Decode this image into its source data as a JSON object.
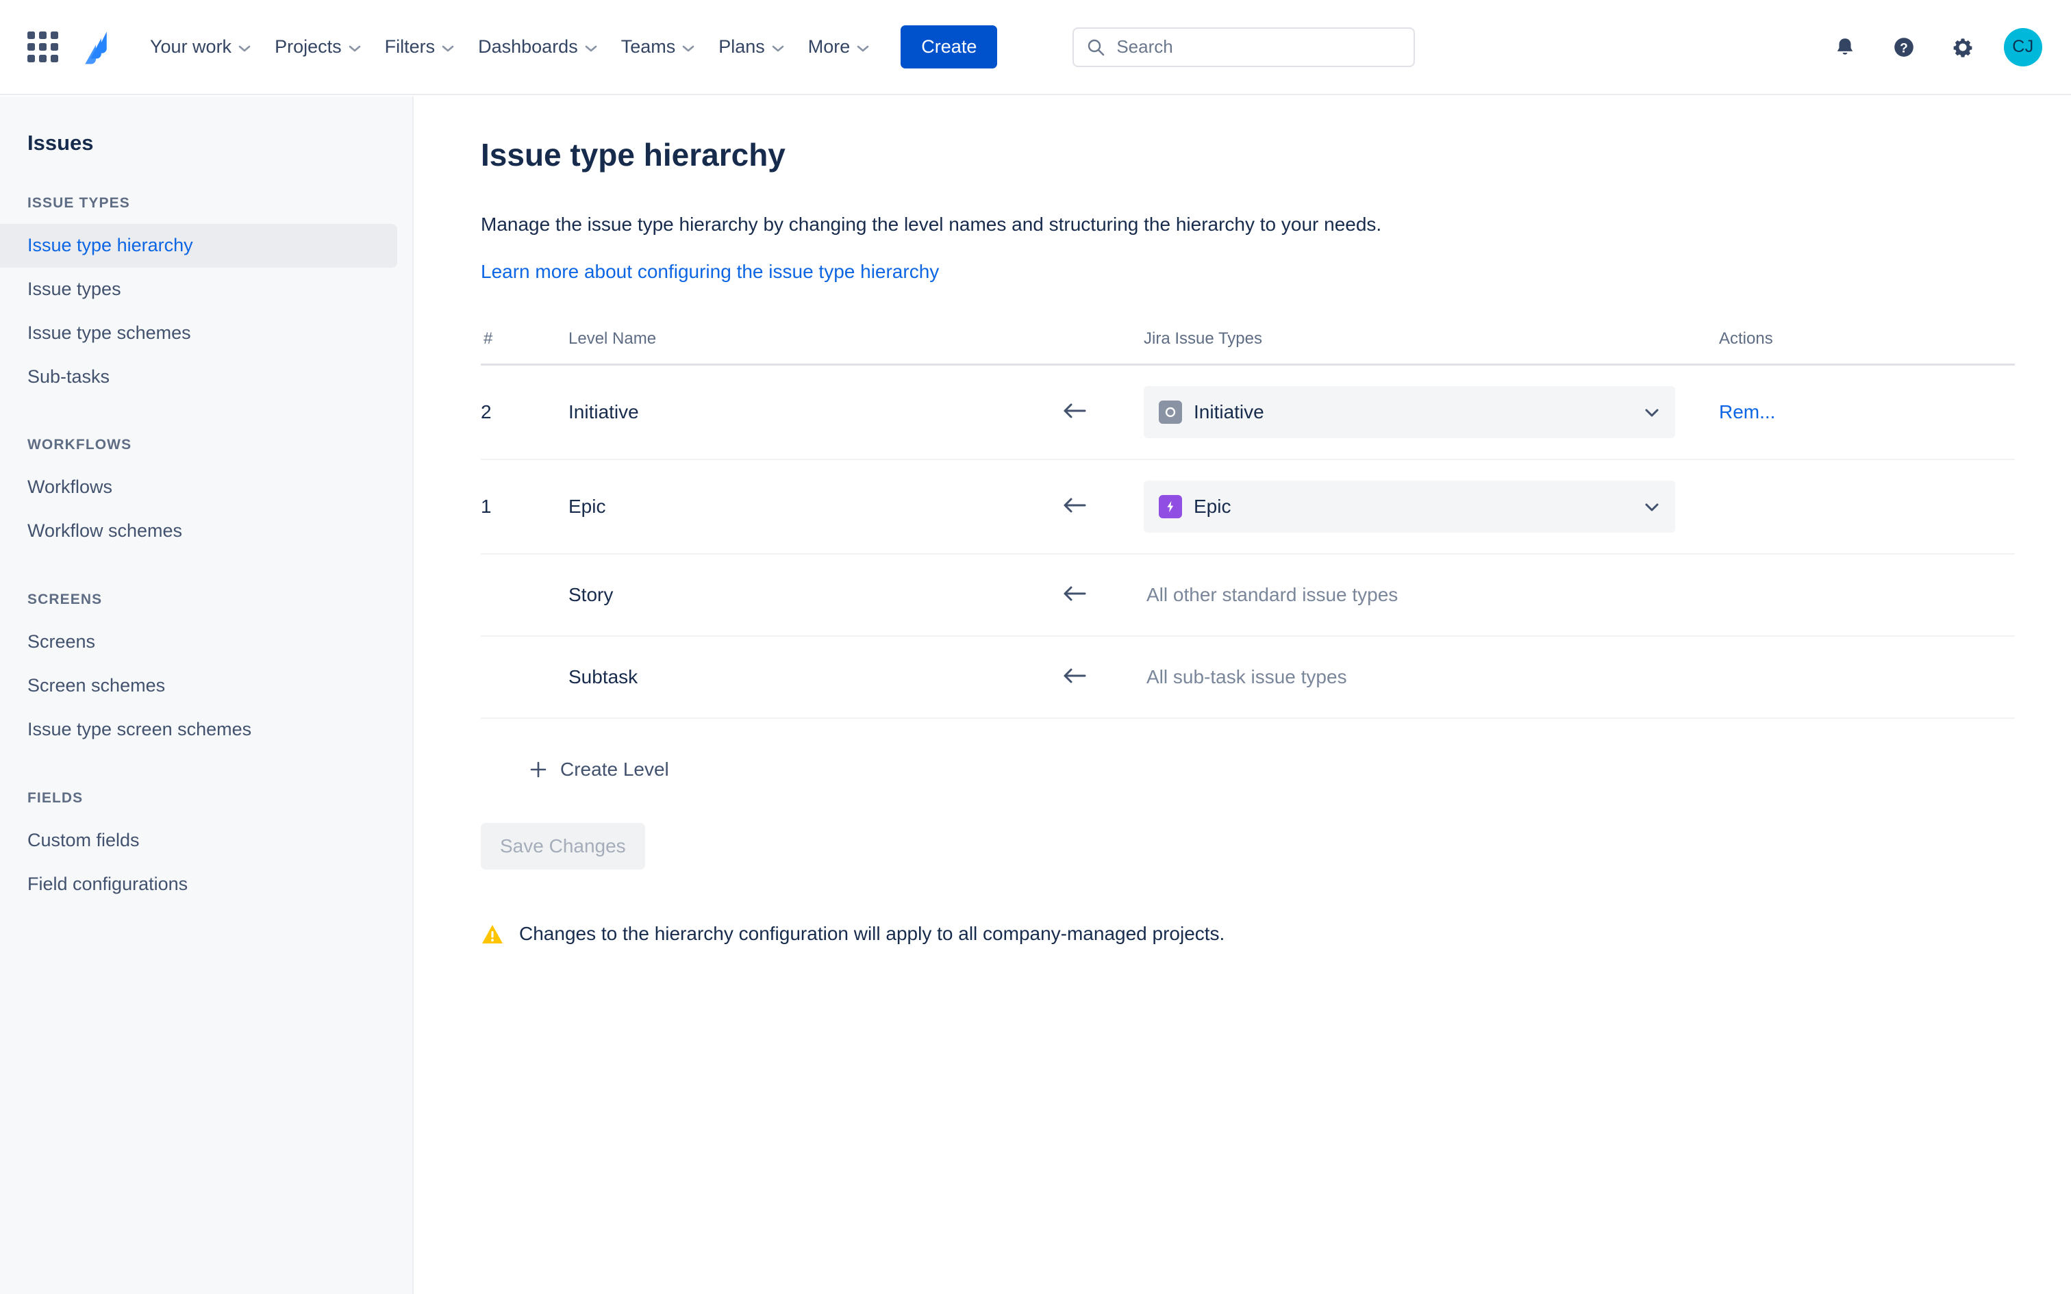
{
  "topnav": {
    "app_switcher_icon": "grid-apps-icon",
    "logo_icon": "jira-logo-icon",
    "items": [
      {
        "label": "Your work",
        "has_chevron": true
      },
      {
        "label": "Projects",
        "has_chevron": true
      },
      {
        "label": "Filters",
        "has_chevron": true
      },
      {
        "label": "Dashboards",
        "has_chevron": true
      },
      {
        "label": "Teams",
        "has_chevron": true
      },
      {
        "label": "Plans",
        "has_chevron": true
      },
      {
        "label": "More",
        "has_chevron": true
      }
    ],
    "create_label": "Create",
    "search": {
      "placeholder": "Search",
      "value": "",
      "icon": "search-icon"
    },
    "right_icons": [
      {
        "name": "notifications-bell-icon"
      },
      {
        "name": "help-question-icon"
      },
      {
        "name": "settings-gear-icon"
      }
    ],
    "avatar_initials": "CJ",
    "avatar_color": "#00b8d9",
    "create_button_color": "#0052cc"
  },
  "sidebar": {
    "title": "Issues",
    "sections": [
      {
        "heading": "ISSUE TYPES",
        "items": [
          {
            "label": "Issue type hierarchy",
            "active": true
          },
          {
            "label": "Issue types",
            "active": false
          },
          {
            "label": "Issue type schemes",
            "active": false
          },
          {
            "label": "Sub-tasks",
            "active": false
          }
        ]
      },
      {
        "heading": "WORKFLOWS",
        "items": [
          {
            "label": "Workflows",
            "active": false
          },
          {
            "label": "Workflow schemes",
            "active": false
          }
        ]
      },
      {
        "heading": "SCREENS",
        "items": [
          {
            "label": "Screens",
            "active": false
          },
          {
            "label": "Screen schemes",
            "active": false
          },
          {
            "label": "Issue type screen schemes",
            "active": false
          }
        ]
      },
      {
        "heading": "FIELDS",
        "items": [
          {
            "label": "Custom fields",
            "active": false
          },
          {
            "label": "Field configurations",
            "active": false
          }
        ]
      }
    ],
    "active_color": "#0c66e4",
    "active_bg": "#ebecf0"
  },
  "main": {
    "title": "Issue type hierarchy",
    "description": "Manage the issue type hierarchy by changing the level names and structuring the hierarchy to your needs.",
    "learn_more_label": "Learn more about configuring the issue type hierarchy",
    "table": {
      "headers": {
        "num": "#",
        "level_name": "Level Name",
        "jira_issue_types": "Jira Issue Types",
        "actions": "Actions"
      },
      "rows": [
        {
          "num": "2",
          "level_name": "Initiative",
          "arrow_icon": "arrow-left-icon",
          "type_kind": "select",
          "type_label": "Initiative",
          "type_icon": "initiative-circle-icon",
          "type_icon_color": "#8993a4",
          "action_label": "Rem..."
        },
        {
          "num": "1",
          "level_name": "Epic",
          "arrow_icon": "arrow-left-icon",
          "type_kind": "select",
          "type_label": "Epic",
          "type_icon": "epic-bolt-icon",
          "type_icon_color": "#904ee2",
          "action_label": ""
        },
        {
          "num": "",
          "level_name": "Story",
          "arrow_icon": "arrow-left-icon",
          "type_kind": "static",
          "type_label": "All other standard issue types",
          "action_label": ""
        },
        {
          "num": "",
          "level_name": "Subtask",
          "arrow_icon": "arrow-left-icon",
          "type_kind": "static",
          "type_label": "All sub-task issue types",
          "action_label": ""
        }
      ]
    },
    "create_level_label": "Create Level",
    "create_level_icon": "plus-icon",
    "save_changes_label": "Save Changes",
    "save_changes_disabled": true,
    "warning": {
      "icon": "warning-triangle-icon",
      "text": "Changes to the hierarchy configuration will apply to all company-managed projects.",
      "icon_color": "#ffc400"
    }
  }
}
